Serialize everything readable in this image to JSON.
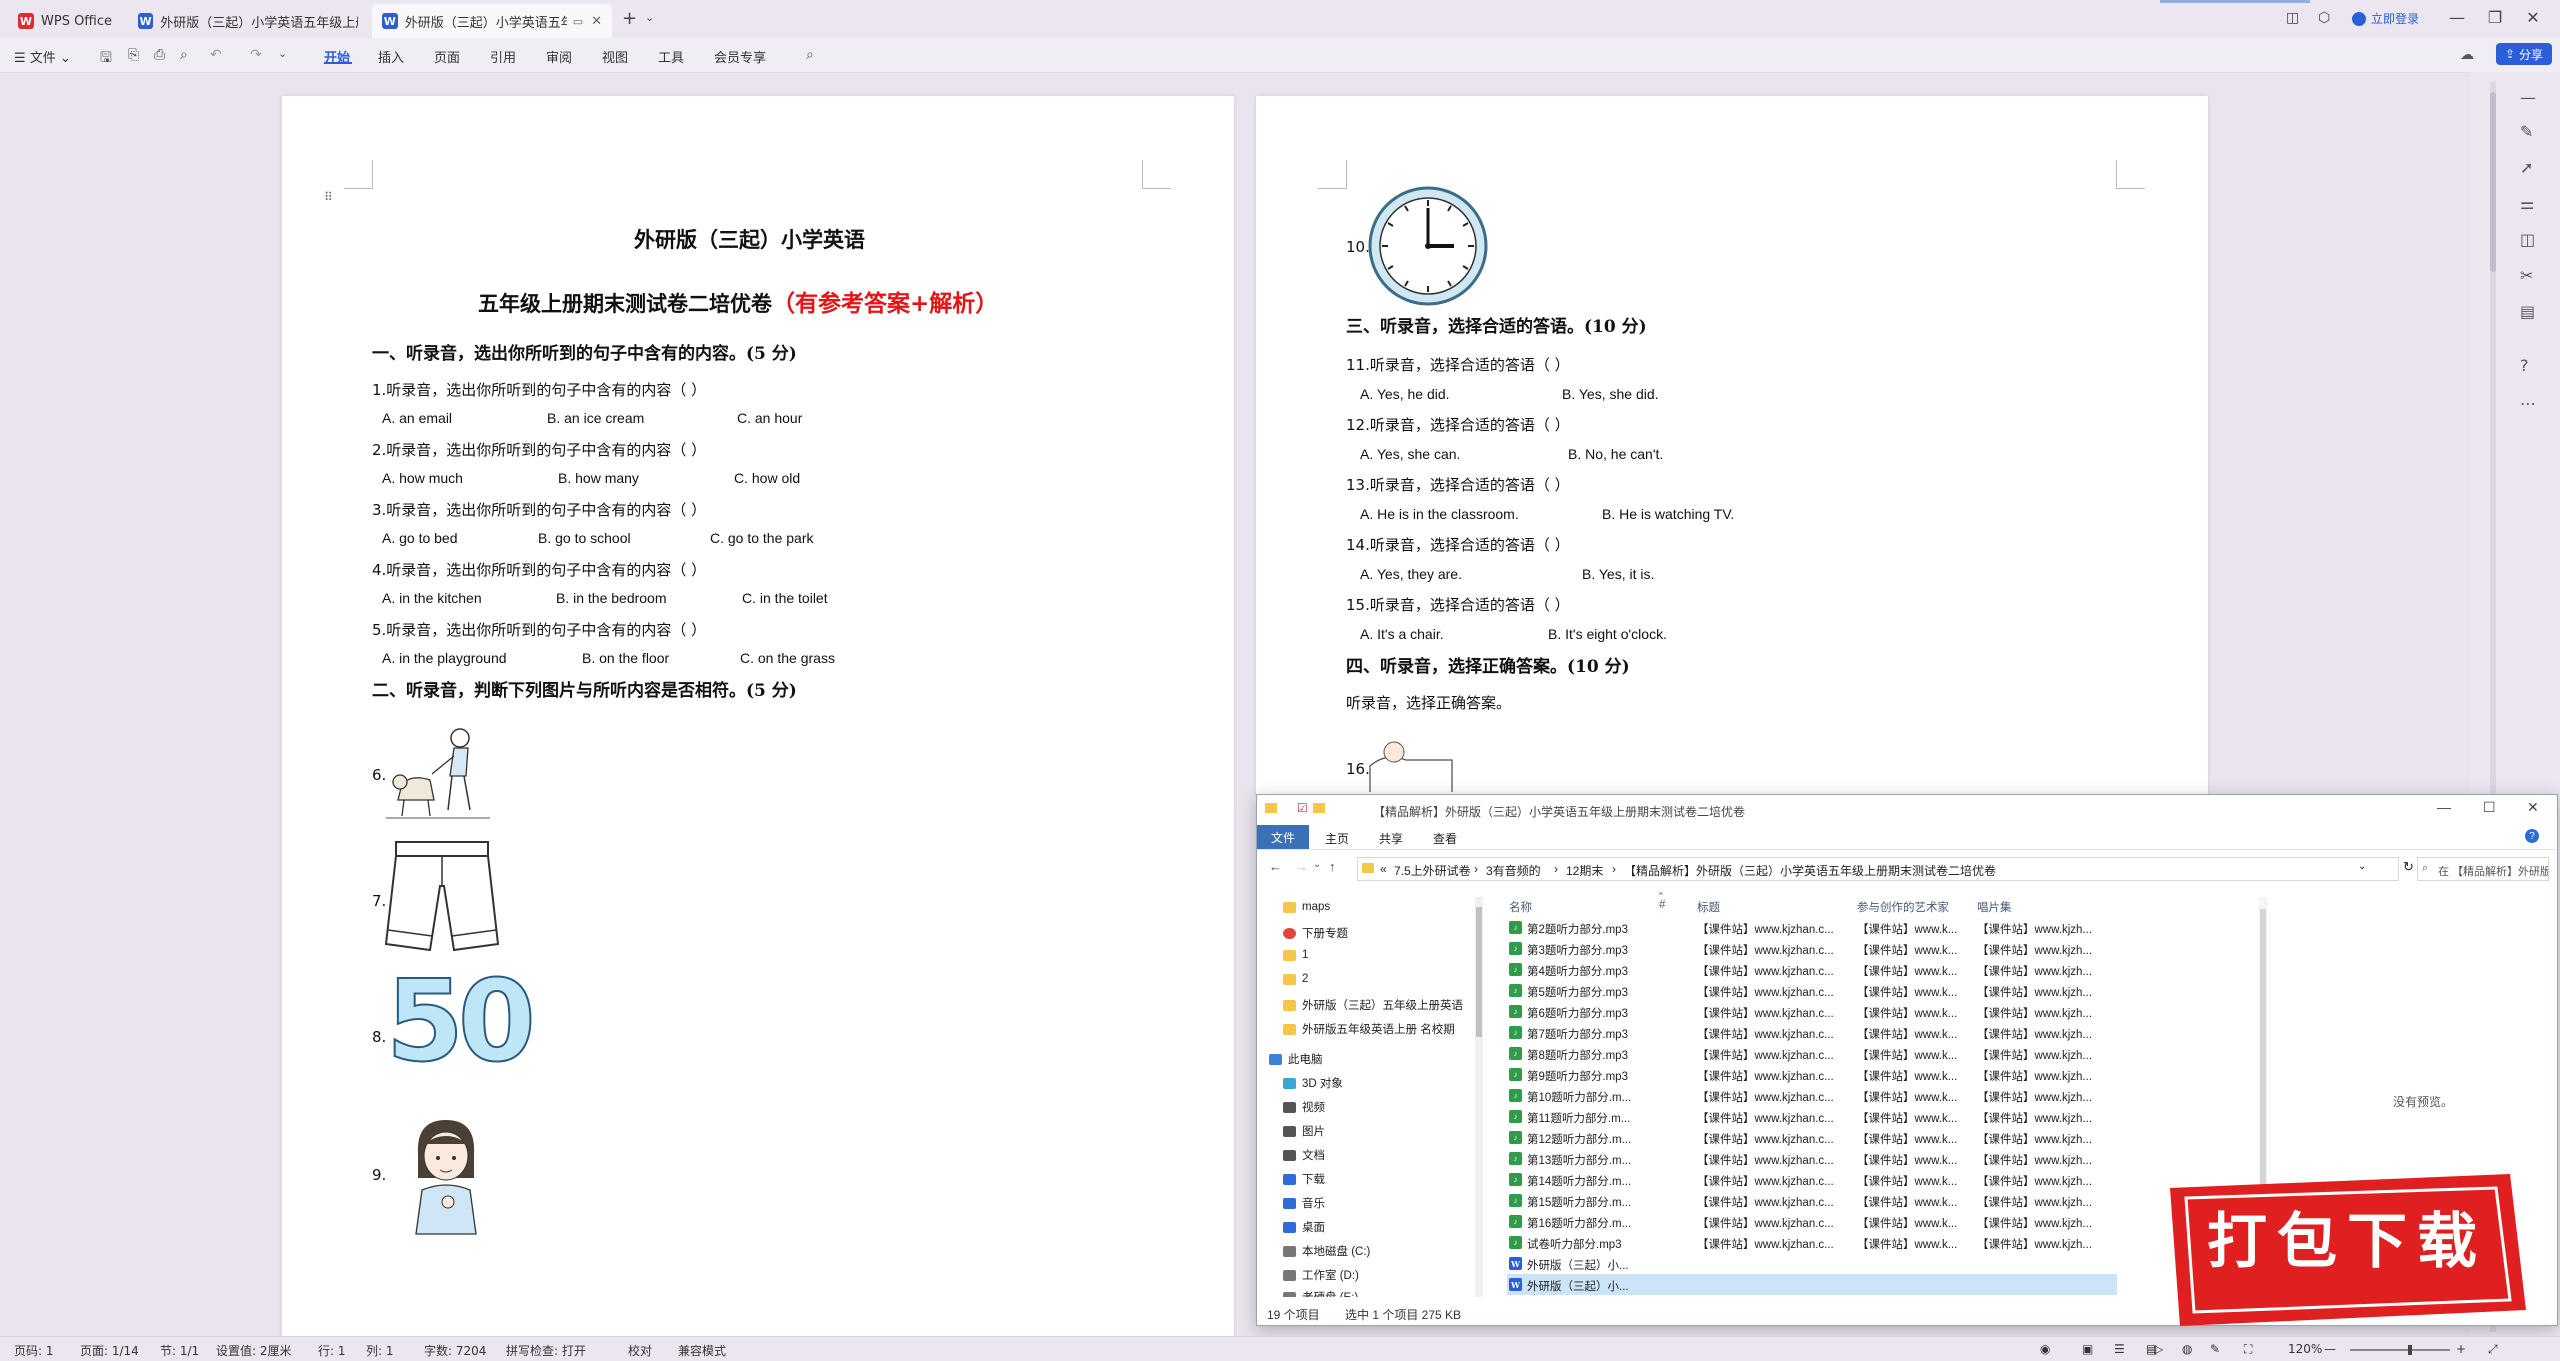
{
  "tabs": {
    "app": "WPS Office",
    "doc1": "外研版（三起）小学英语五年级上册",
    "doc2": "外研版（三起）小学英语五年级",
    "login": "立即登录",
    "share": "分享"
  },
  "ribbon": {
    "file": "文件",
    "items": [
      "开始",
      "插入",
      "页面",
      "引用",
      "审阅",
      "视图",
      "工具",
      "会员专享"
    ]
  },
  "page1": {
    "title": "外研版（三起）小学英语",
    "subtitle": "五年级上册期末测试卷二培优卷",
    "subtitle_red": "（有参考答案+解析）",
    "sec1": "一、听录音，选出你所听到的句子中含有的内容。(5 分)",
    "questions": [
      {
        "q": "1.听录音，选出你所听到的句子中含有的内容（    ）",
        "a": "A. an email",
        "b": "B. an ice cream",
        "c": "C. an hour"
      },
      {
        "q": "2.听录音，选出你所听到的句子中含有的内容（    ）",
        "a": "A. how much",
        "b": "B. how many",
        "c": "C. how old"
      },
      {
        "q": "3.听录音，选出你所听到的句子中含有的内容（    ）",
        "a": "A. go to bed",
        "b": "B. go to school",
        "c": "C. go to the park"
      },
      {
        "q": "4.听录音，选出你所听到的句子中含有的内容（    ）",
        "a": "A. in the kitchen",
        "b": "B. in the bedroom",
        "c": "C. in the toilet"
      },
      {
        "q": "5.听录音，选出你所听到的句子中含有的内容（    ）",
        "a": "A. in the playground",
        "b": "B. on the floor",
        "c": "C. on the grass"
      }
    ],
    "sec2": "二、听录音，判断下列图片与所听内容是否相符。(5 分)",
    "pic_labels": [
      "6.",
      "7.",
      "8.",
      "9."
    ],
    "pic_number": "50"
  },
  "page2": {
    "q10": "10.",
    "sec3": "三、听录音，选择合适的答语。(10 分)",
    "questions": [
      {
        "q": "11.听录音，选择合适的答语（    ）",
        "a": "A. Yes, he did.",
        "b": "B. Yes, she did."
      },
      {
        "q": "12.听录音，选择合适的答语（    ）",
        "a": "A. Yes, she can.",
        "b": "B. No, he can't."
      },
      {
        "q": "13.听录音，选择合适的答语（    ）",
        "a": "A. He is in the classroom.",
        "b": "B. He is watching TV."
      },
      {
        "q": "14.听录音，选择合适的答语（    ）",
        "a": "A. Yes, they are.",
        "b": "B. Yes, it is."
      },
      {
        "q": "15.听录音，选择合适的答语（    ）",
        "a": "A. It's a chair.",
        "b": "B. It's eight o'clock."
      }
    ],
    "sec4": "四、听录音，选择正确答案。(10 分)",
    "sec4_text": "听录音，选择正确答案。",
    "q16": "16."
  },
  "explorer": {
    "title": "【精品解析】外研版（三起）小学英语五年级上册期末测试卷二培优卷",
    "menu": [
      "文件",
      "主页",
      "共享",
      "查看"
    ],
    "address": [
      "«",
      "7.5上外研试卷",
      "3有音频的",
      "12期末",
      "【精品解析】外研版（三起）小学英语五年级上册期末测试卷二培优卷"
    ],
    "search": "在 【精品解析】外研版（三起）小学英语五年级上册...",
    "nav": [
      {
        "label": "maps",
        "color": "#f3c84a"
      },
      {
        "label": "下册专题",
        "color": "#e0443a"
      },
      {
        "label": "1",
        "color": "#f3c84a"
      },
      {
        "label": "2",
        "color": "#f3c84a"
      },
      {
        "label": "外研版（三起）五年级上册英语",
        "color": "#f3c84a"
      },
      {
        "label": "外研版五年级英语上册 名校期",
        "color": "#f3c84a"
      },
      {
        "label": "此电脑",
        "color": "#3b82d6"
      },
      {
        "label": "3D 对象",
        "color": "#3ba4d6"
      },
      {
        "label": "视频",
        "color": "#555"
      },
      {
        "label": "图片",
        "color": "#555"
      },
      {
        "label": "文档",
        "color": "#555"
      },
      {
        "label": "下载",
        "color": "#2b6fd6"
      },
      {
        "label": "音乐",
        "color": "#2b6fd6"
      },
      {
        "label": "桌面",
        "color": "#2b6fd6"
      },
      {
        "label": "本地磁盘 (C:)",
        "color": "#777"
      },
      {
        "label": "工作室 (D:)",
        "color": "#777"
      },
      {
        "label": "老硬盘 (E:)",
        "color": "#777"
      }
    ],
    "headers": [
      "名称",
      "#",
      "标题",
      "参与创作的艺术家",
      "唱片集"
    ],
    "files": [
      {
        "name": "第2题听力部分.mp3",
        "type": "mp3"
      },
      {
        "name": "第3题听力部分.mp3",
        "type": "mp3"
      },
      {
        "name": "第4题听力部分.mp3",
        "type": "mp3"
      },
      {
        "name": "第5题听力部分.mp3",
        "type": "mp3"
      },
      {
        "name": "第6题听力部分.mp3",
        "type": "mp3"
      },
      {
        "name": "第7题听力部分.mp3",
        "type": "mp3"
      },
      {
        "name": "第8题听力部分.mp3",
        "type": "mp3"
      },
      {
        "name": "第9题听力部分.mp3",
        "type": "mp3"
      },
      {
        "name": "第10题听力部分.m...",
        "type": "mp3"
      },
      {
        "name": "第11题听力部分.m...",
        "type": "mp3"
      },
      {
        "name": "第12题听力部分.m...",
        "type": "mp3"
      },
      {
        "name": "第13题听力部分.m...",
        "type": "mp3"
      },
      {
        "name": "第14题听力部分.m...",
        "type": "mp3"
      },
      {
        "name": "第15题听力部分.m...",
        "type": "mp3"
      },
      {
        "name": "第16题听力部分.m...",
        "type": "mp3"
      },
      {
        "name": "试卷听力部分.mp3",
        "type": "mp3"
      },
      {
        "name": "外研版（三起）小...",
        "type": "doc"
      },
      {
        "name": "外研版（三起）小...",
        "type": "doc",
        "selected": true
      }
    ],
    "meta_title": "【课件站】www.kjzhan.c...",
    "meta_artist": "【课件站】www.k...",
    "meta_album": "【课件站】www.kjzh...",
    "preview": "没有预览。",
    "status_count": "19 个项目",
    "status_sel": "选中 1 个项目  275 KB"
  },
  "status": {
    "page": "页码: 1",
    "pages": "页面: 1/14",
    "section": "节: 1/1",
    "setting": "设置值: 2厘米",
    "row": "行: 1",
    "col": "列: 1",
    "words": "字数: 7204",
    "spell": "拼写检查: 打开",
    "proof": "校对",
    "compat": "兼容模式",
    "zoom": "120%"
  },
  "badge": "打包下载"
}
